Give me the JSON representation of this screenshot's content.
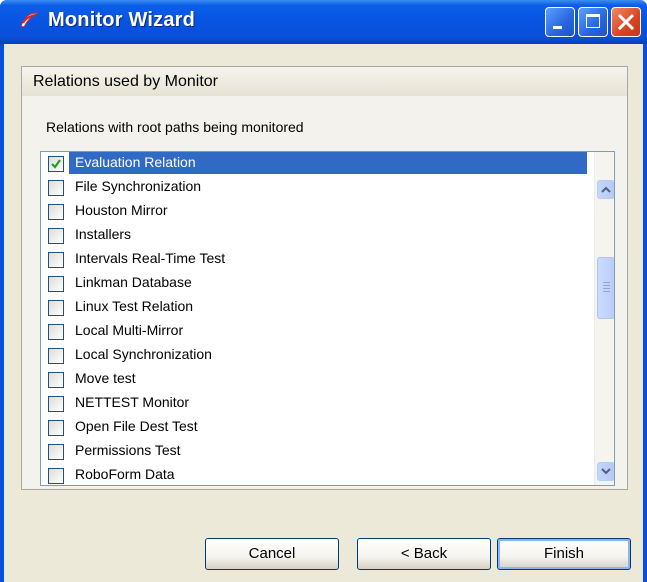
{
  "window": {
    "title": "Monitor Wizard",
    "icon": "monitor-app-icon"
  },
  "titlebar_buttons": [
    "minimize",
    "maximize",
    "close"
  ],
  "page": {
    "header": "Relations used by Monitor",
    "subtitle": "Relations with root paths being monitored"
  },
  "relations": [
    {
      "label": "Evaluation Relation",
      "checked": true,
      "selected": true
    },
    {
      "label": "File Synchronization",
      "checked": false,
      "selected": false
    },
    {
      "label": "Houston Mirror",
      "checked": false,
      "selected": false
    },
    {
      "label": "Installers",
      "checked": false,
      "selected": false
    },
    {
      "label": "Intervals Real-Time Test",
      "checked": false,
      "selected": false
    },
    {
      "label": "Linkman Database",
      "checked": false,
      "selected": false
    },
    {
      "label": "Linux Test Relation",
      "checked": false,
      "selected": false
    },
    {
      "label": "Local Multi-Mirror",
      "checked": false,
      "selected": false
    },
    {
      "label": "Local Synchronization",
      "checked": false,
      "selected": false
    },
    {
      "label": "Move test",
      "checked": false,
      "selected": false
    },
    {
      "label": "NETTEST Monitor",
      "checked": false,
      "selected": false
    },
    {
      "label": "Open File Dest Test",
      "checked": false,
      "selected": false
    },
    {
      "label": "Permissions Test",
      "checked": false,
      "selected": false
    },
    {
      "label": "RoboForm Data",
      "checked": false,
      "selected": false
    }
  ],
  "buttons": {
    "cancel": "Cancel",
    "back": "< Back",
    "finish": "Finish"
  },
  "colors": {
    "titlebar": "#0754e2",
    "selection": "#316ac5",
    "check": "#21a121",
    "dialog_bg": "#ece9d8"
  }
}
